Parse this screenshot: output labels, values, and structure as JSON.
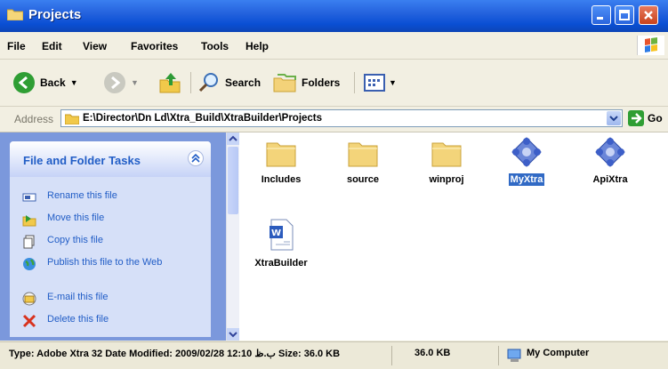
{
  "window": {
    "title": "Projects"
  },
  "menu": [
    "File",
    "Edit",
    "View",
    "Favorites",
    "Tools",
    "Help"
  ],
  "toolbar": {
    "back": "Back",
    "search": "Search",
    "folders": "Folders"
  },
  "address": {
    "label": "Address",
    "path": "E:\\Director\\Dn Ld\\Xtra_Build\\XtraBuilder\\Projects",
    "go": "Go"
  },
  "tasks": {
    "title": "File and Folder Tasks",
    "items": [
      {
        "label": "Rename this file",
        "icon": "rename-icon"
      },
      {
        "label": "Move this file",
        "icon": "move-icon"
      },
      {
        "label": "Copy this file",
        "icon": "copy-icon"
      },
      {
        "label": "Publish this file to the Web",
        "icon": "globe-icon"
      },
      {
        "label": "E-mail this file",
        "icon": "email-icon"
      },
      {
        "label": "Delete this file",
        "icon": "delete-icon"
      }
    ]
  },
  "files": [
    {
      "name": "Includes",
      "type": "folder"
    },
    {
      "name": "source",
      "type": "folder"
    },
    {
      "name": "winproj",
      "type": "folder"
    },
    {
      "name": "MyXtra",
      "type": "xtra",
      "selected": true
    },
    {
      "name": "ApiXtra",
      "type": "xtra"
    },
    {
      "name": "XtraBuilder",
      "type": "word"
    }
  ],
  "status": {
    "info": "Type: Adobe Xtra 32 Date Modified: 2009/02/28 12:10 ب.ظ Size: 36.0 KB",
    "size": "36.0 KB",
    "zone": "My Computer"
  },
  "colors": {
    "title_bar": "#0a4fd4",
    "task_link": "#215dc6",
    "selection": "#316ac5",
    "task_pane": "#7b98dc"
  }
}
